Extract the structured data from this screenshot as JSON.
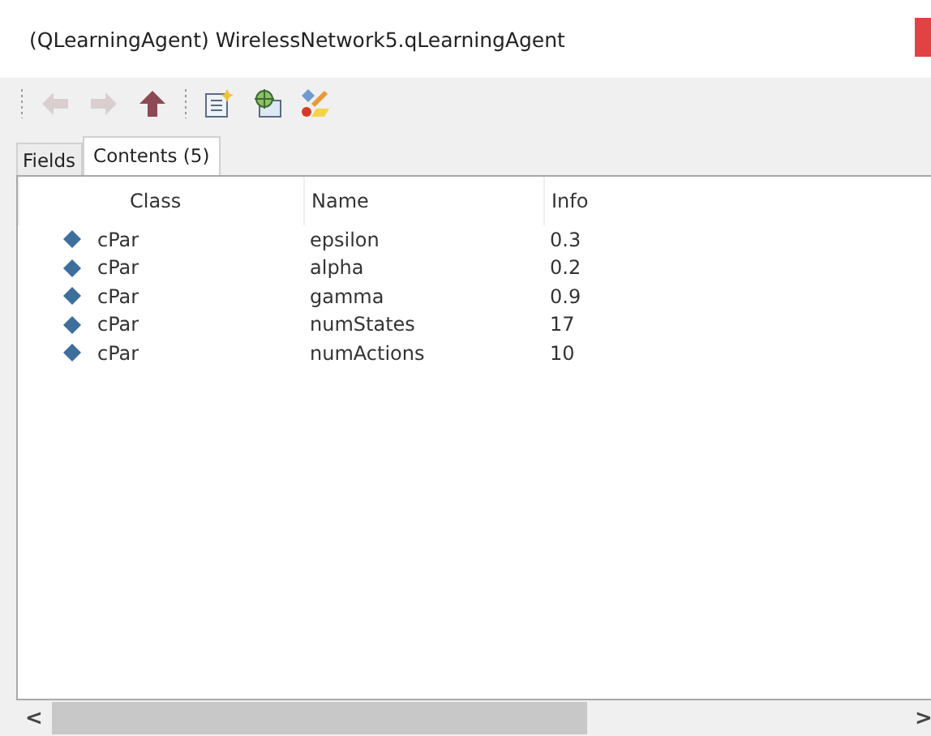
{
  "window": {
    "title": "(QLearningAgent) WirelessNetwork5.qLearningAgent"
  },
  "toolbar": [
    {
      "kind": "back",
      "disabled": true
    },
    {
      "kind": "forward",
      "disabled": true
    },
    {
      "kind": "up",
      "disabled": false
    },
    {
      "kind": "separator"
    },
    {
      "kind": "inspect"
    },
    {
      "kind": "network"
    },
    {
      "kind": "objects"
    }
  ],
  "tabs": [
    {
      "label": "Fields",
      "selected": false
    },
    {
      "label": "Contents (5)",
      "selected": true
    }
  ],
  "table": {
    "columns": [
      "Class",
      "Name",
      "Info"
    ],
    "rows": [
      {
        "class": "cPar",
        "name": "epsilon",
        "info": "0.3"
      },
      {
        "class": "cPar",
        "name": "alpha",
        "info": "0.2"
      },
      {
        "class": "cPar",
        "name": "gamma",
        "info": "0.9"
      },
      {
        "class": "cPar",
        "name": "numStates",
        "info": "17"
      },
      {
        "class": "cPar",
        "name": "numActions",
        "info": "10"
      }
    ]
  },
  "scrollbar": {
    "left": "<",
    "right": ">"
  }
}
